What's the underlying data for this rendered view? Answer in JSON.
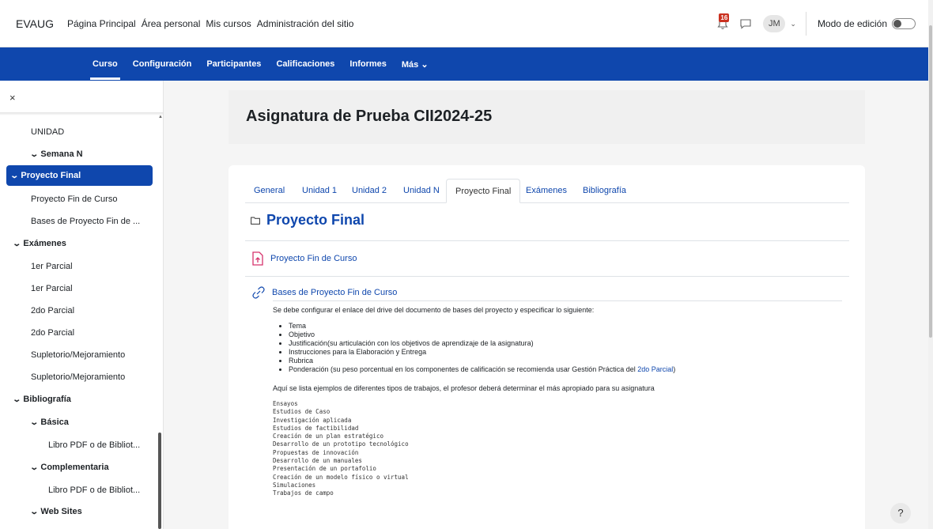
{
  "topbar": {
    "brand": "EVAUG",
    "nav": [
      "Página Principal",
      "Área personal",
      "Mis cursos",
      "Administración del sitio"
    ],
    "notification_count": "16",
    "avatar_initials": "JM",
    "edit_mode_label": "Modo de edición",
    "edit_mode_on": false
  },
  "course_nav": {
    "items": [
      "Curso",
      "Configuración",
      "Participantes",
      "Calificaciones",
      "Informes",
      "Más ⌄"
    ],
    "active": "Curso"
  },
  "drawer": {
    "close_label": "×",
    "items": [
      {
        "label": "UNIDAD",
        "level": 1
      },
      {
        "label": "Semana N",
        "level": 1,
        "chevron": "⌄",
        "bold": true
      },
      {
        "label": "Proyecto Final",
        "level": 0,
        "chevron": "⌄",
        "bold": true,
        "selected": true
      },
      {
        "label": "Proyecto Fin de Curso",
        "level": 1
      },
      {
        "label": "Bases de Proyecto Fin de ...",
        "level": 1
      },
      {
        "label": "Exámenes",
        "level": 0,
        "chevron": "⌄",
        "bold": true
      },
      {
        "label": "1er Parcial",
        "level": 1
      },
      {
        "label": "1er Parcial",
        "level": 1
      },
      {
        "label": "2do Parcial",
        "level": 1
      },
      {
        "label": "2do Parcial",
        "level": 1
      },
      {
        "label": "Supletorio/Mejoramiento",
        "level": 1
      },
      {
        "label": "Supletorio/Mejoramiento",
        "level": 1
      },
      {
        "label": "Bibliografía",
        "level": 0,
        "chevron": "⌄",
        "bold": true
      },
      {
        "label": "Básica",
        "level": 1,
        "chevron": "⌄",
        "bold": true
      },
      {
        "label": "Libro PDF o de Bibliot...",
        "level": 2
      },
      {
        "label": "Complementaria",
        "level": 1,
        "chevron": "⌄",
        "bold": true
      },
      {
        "label": "Libro PDF o de Bibliot...",
        "level": 2
      },
      {
        "label": "Web Sites",
        "level": 1,
        "chevron": "⌄",
        "bold": true
      }
    ]
  },
  "page": {
    "title": "Asignatura de Prueba CII2024-25",
    "tabs": [
      "General",
      "Unidad 1",
      "Unidad 2",
      "Unidad N",
      "Proyecto Final",
      "Exámenes",
      "Bibliografía"
    ],
    "active_tab": "Proyecto Final",
    "section_title": "Proyecto Final",
    "activities": [
      {
        "label": "Proyecto Fin de Curso",
        "icon": "assignment-upload-icon"
      },
      {
        "label": "Bases de Proyecto Fin de Curso",
        "icon": "url-link-icon"
      }
    ],
    "description": {
      "intro": "Se debe configurar el enlace del drive del documento de bases del proyecto y especificar lo siguiente:",
      "bullets": [
        "Tema",
        "Objetivo",
        "Justificación(su articulación con los objetivos de aprendizaje de la asignatura)",
        "Instrucciones para la Elaboración y Entrega",
        "Rubrica"
      ],
      "last_bullet_text": "Ponderación (su peso porcentual en los componentes de calificación se recomienda usar Gestión Práctica del ",
      "last_bullet_link": "2do Parcial",
      "last_bullet_end": ")",
      "examples_intro": "Aquí se lista ejemplos de diferentes tipos de trabajos, el profesor  deberá determinar el más apropiado para su asignatura",
      "examples": [
        "Ensayos",
        "Estudios de Caso",
        "Investigación aplicada",
        "Estudios de factibilidad",
        "Creación de un plan estratégico",
        "Desarrollo de un prototipo tecnológico",
        "Propuestas de innovación",
        "Desarrollo de un manuales",
        "Presentación de un portafolio",
        "Creación de un modelo físico o virtual",
        "Simulaciones",
        "Trabajos de campo"
      ]
    }
  },
  "help_label": "?",
  "colors": {
    "primary": "#0f47ad",
    "badge": "#ca3120",
    "upload_icon": "#d6336c"
  }
}
